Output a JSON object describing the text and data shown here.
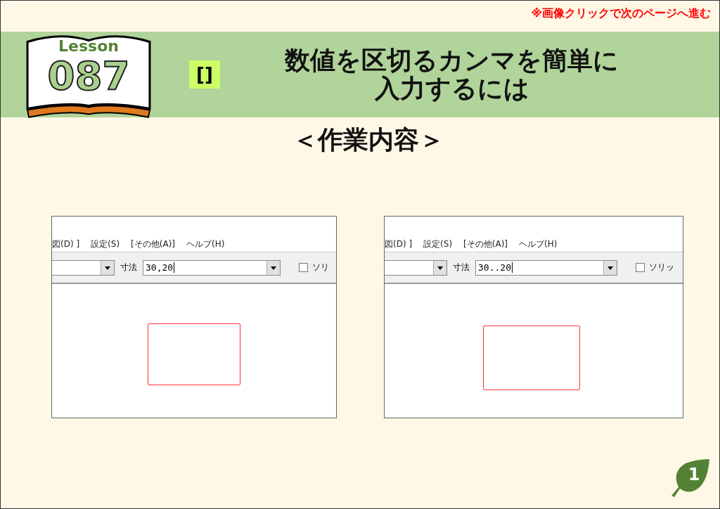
{
  "notice": "※画像クリックで次のページへ進む",
  "lesson": {
    "label": "Lesson",
    "number": "087"
  },
  "tag": "[]",
  "title": [
    "数値を区切るカンマを簡単に",
    "入力するには"
  ],
  "subtitle": "＜作業内容＞",
  "screens": [
    {
      "menu": [
        "図(D) ]",
        "設定(S)",
        "[その他(A)]",
        "ヘルプ(H)"
      ],
      "size_label": "寸法",
      "size_value": "30,20",
      "checkbox": {
        "label": "ソリ",
        "checked": false
      }
    },
    {
      "menu": [
        "図(D) ]",
        "設定(S)",
        "[その他(A)]",
        "ヘルプ(H)"
      ],
      "size_label": "寸法",
      "size_value": "30..20",
      "checkbox": {
        "label": "ソリッ",
        "checked": false
      }
    }
  ],
  "page": "1"
}
